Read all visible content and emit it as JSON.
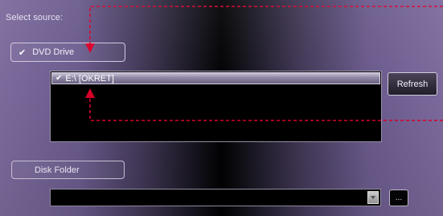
{
  "source": {
    "label": "Select source:",
    "dvd_drive": {
      "label": "DVD Drive",
      "checked": true,
      "check_glyph": "✔"
    },
    "drives": [
      {
        "label": "E:\\ [OKRET]",
        "checked": true,
        "check_glyph": "✔"
      }
    ],
    "refresh_label": "Refresh",
    "disk_folder": {
      "label": "Disk Folder",
      "checked": false
    },
    "folder_path": {
      "value": "",
      "browse_label": "..."
    }
  },
  "annotation": {
    "color": "#d8002a",
    "style": "dashed",
    "arrows": [
      "dvd-drive",
      "drive-item"
    ]
  }
}
